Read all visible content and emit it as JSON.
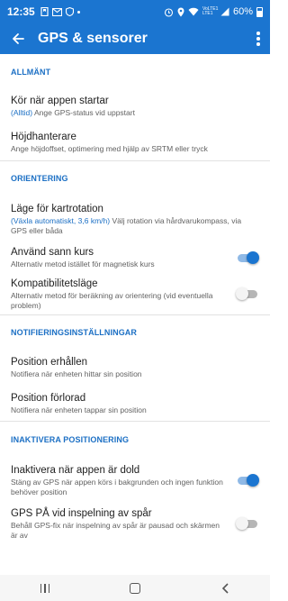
{
  "status_bar": {
    "time": "12:35",
    "battery": "60%",
    "network": "VoLTE1 LTE1"
  },
  "app_bar": {
    "title": "GPS & sensorer"
  },
  "sections": {
    "general": {
      "header": "ALLMÄNT",
      "start_on_launch": {
        "title": "Kör när appen startar",
        "summary_highlight": "(Alltid)",
        "summary_rest": " Ange GPS-status vid uppstart"
      },
      "altitude": {
        "title": "Höjdhanterare",
        "summary": "Ange höjdoffset, optimering med hjälp av SRTM eller tryck"
      }
    },
    "orientation": {
      "header": "ORIENTERING",
      "map_rotation": {
        "title": "Läge för kartrotation",
        "summary_highlight": "(Växla automatiskt, 3,6 km/h)",
        "summary_rest": " Välj rotation via hårdvarukompass, via GPS eller båda"
      },
      "true_course": {
        "title": "Använd sann kurs",
        "summary": "Alternativ metod istället för magnetisk kurs",
        "enabled": true
      },
      "compatibility": {
        "title": "Kompatibilitetsläge",
        "summary": "Alternativ metod för beräkning av orientering (vid eventuella problem)",
        "enabled": false
      }
    },
    "notifications": {
      "header": "NOTIFIERINGSINSTÄLLNINGAR",
      "position_acquired": {
        "title": "Position erhållen",
        "summary": "Notifiera när enheten hittar sin position"
      },
      "position_lost": {
        "title": "Position förlorad",
        "summary": "Notifiera när enheten tappar sin position"
      }
    },
    "disable_positioning": {
      "header": "INAKTIVERA POSITIONERING",
      "disable_when_hidden": {
        "title": "Inaktivera när appen är dold",
        "summary": "Stäng av GPS när appen körs i bakgrunden och ingen funktion behöver position",
        "enabled": true
      },
      "gps_on_recording": {
        "title": "GPS PÅ vid inspelning av spår",
        "summary": "Behåll GPS-fix när inspelning av spår är pausad och skärmen är av",
        "enabled": false
      }
    }
  },
  "colors": {
    "primary": "#1b75d0",
    "accent_text": "#1b6fc4"
  }
}
